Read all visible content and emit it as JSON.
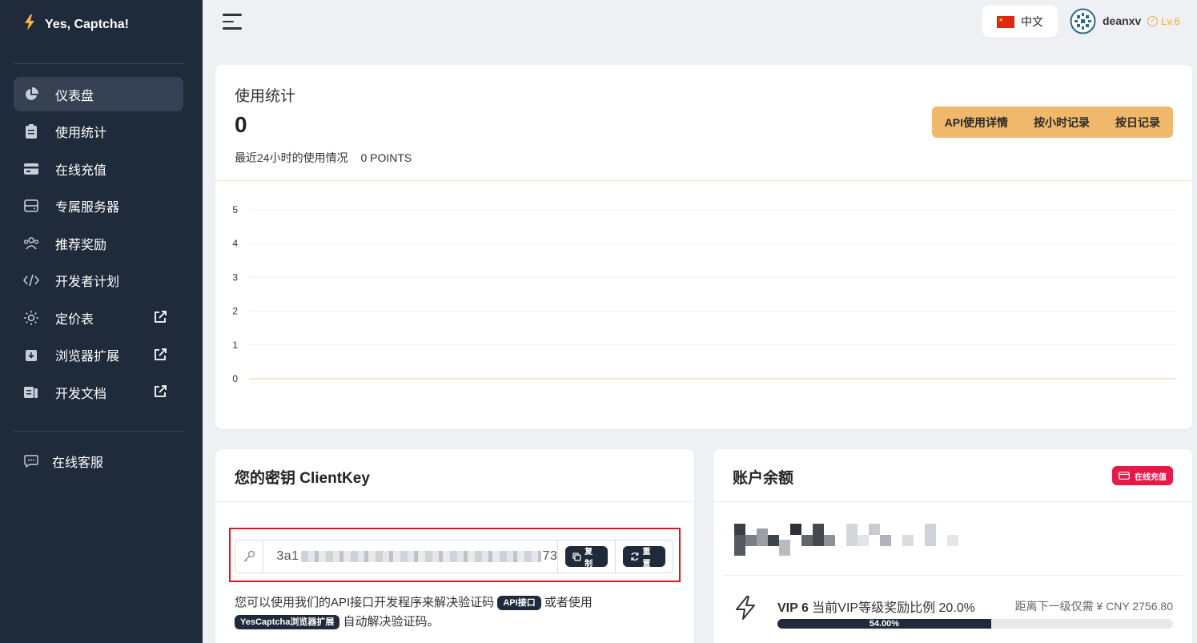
{
  "app": {
    "brand": "Yes, Captcha!"
  },
  "sidebar": {
    "items": [
      {
        "label": "仪表盘",
        "icon": "pie-chart-icon",
        "active": true,
        "external": false
      },
      {
        "label": "使用统计",
        "icon": "clipboard-icon",
        "active": false,
        "external": false
      },
      {
        "label": "在线充值",
        "icon": "credit-card-icon",
        "active": false,
        "external": false
      },
      {
        "label": "专属服务器",
        "icon": "server-icon",
        "active": false,
        "external": false
      },
      {
        "label": "推荐奖励",
        "icon": "users-icon",
        "active": false,
        "external": false
      },
      {
        "label": "开发者计划",
        "icon": "code-icon",
        "active": false,
        "external": false
      },
      {
        "label": "定价表",
        "icon": "sun-icon",
        "active": false,
        "external": true
      },
      {
        "label": "浏览器扩展",
        "icon": "download-box-icon",
        "active": false,
        "external": true
      },
      {
        "label": "开发文档",
        "icon": "document-icon",
        "active": false,
        "external": true
      }
    ],
    "support_label": "在线客服"
  },
  "header": {
    "language": "中文",
    "username": "deanxv",
    "level": "Lv.6"
  },
  "stats": {
    "title": "使用统计",
    "count": "0",
    "subtitle": "最近24小时的使用情况",
    "points": "0 POINTS",
    "buttons": [
      "API使用详情",
      "按小时记录",
      "按日记录"
    ]
  },
  "chart_data": {
    "type": "line",
    "ylim": [
      0,
      5
    ],
    "y_ticks": [
      "0",
      "1",
      "2",
      "3",
      "4",
      "5"
    ],
    "series": [
      {
        "values": []
      }
    ]
  },
  "clientkey": {
    "title": "您的密钥 ClientKey",
    "key_prefix": "3a1",
    "key_suffix": "73",
    "copy_label": "复制",
    "reset_label": "重置",
    "desc_part1": "您可以使用我们的API接口开发程序来解决验证码",
    "api_tag": "API接口",
    "desc_part2": "或者使用",
    "ext_tag": "YesCaptcha浏览器扩展",
    "desc_part3": "自动解决验证码。"
  },
  "balance": {
    "title": "账户余额",
    "recharge_label": "在线充值",
    "vip_label": "VIP 6",
    "vip_ratio": "当前VIP等级奖励比例 20.0%",
    "next_level": "距离下一级仅需 ¥ CNY 2756.80",
    "progress": 54.0,
    "progress_label": "54.00%"
  },
  "colors": {
    "sidebar_bg": "#1f2a3a",
    "accent_orange": "#f0b86a",
    "recharge_red": "#e8194a",
    "highlight_red": "#e0141e"
  }
}
